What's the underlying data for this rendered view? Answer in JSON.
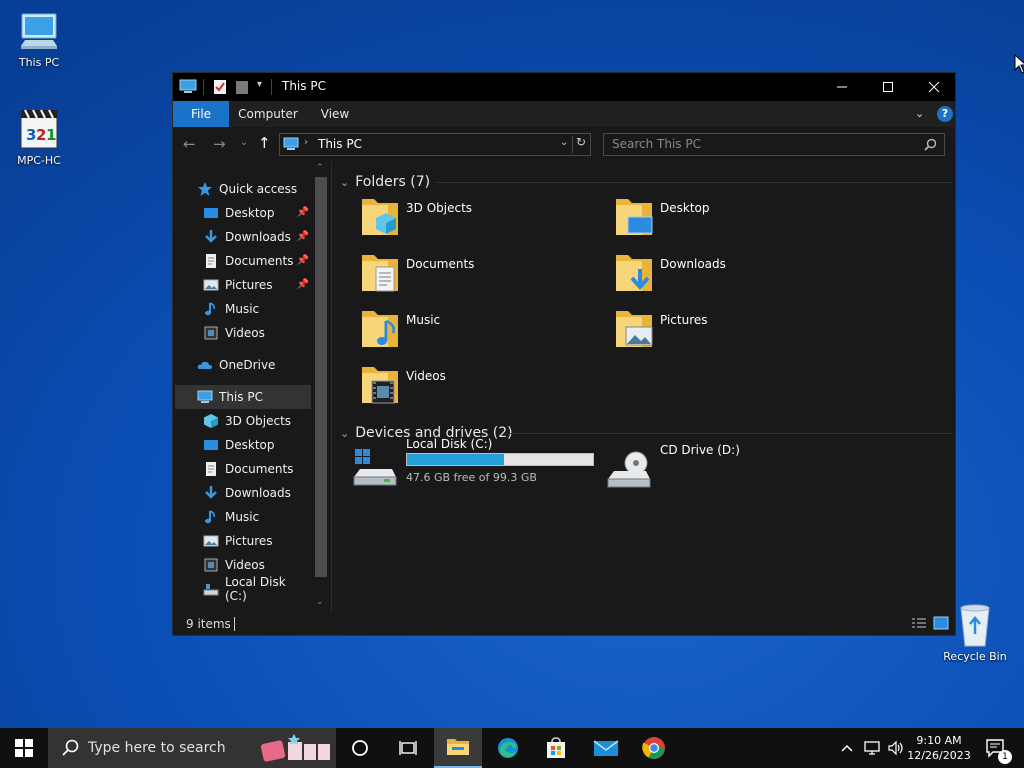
{
  "desktop": {
    "icons": [
      {
        "label": "This PC"
      },
      {
        "label": "MPC-HC"
      },
      {
        "label": "Recycle Bin"
      }
    ]
  },
  "window": {
    "title": "This PC",
    "ribbon_tabs": [
      "File",
      "Computer",
      "View"
    ],
    "address_path": "This PC",
    "search_placeholder": "Search This PC",
    "status_items": "9 items"
  },
  "nav": {
    "quick_access": "Quick access",
    "quick_items": [
      {
        "label": "Desktop",
        "pinned": true
      },
      {
        "label": "Downloads",
        "pinned": true
      },
      {
        "label": "Documents",
        "pinned": true
      },
      {
        "label": "Pictures",
        "pinned": true
      },
      {
        "label": "Music",
        "pinned": false
      },
      {
        "label": "Videos",
        "pinned": false
      }
    ],
    "onedrive": "OneDrive",
    "this_pc": "This PC",
    "pc_items": [
      "3D Objects",
      "Desktop",
      "Documents",
      "Downloads",
      "Music",
      "Pictures",
      "Videos",
      "Local Disk (C:)"
    ]
  },
  "content": {
    "folders_header": "Folders (7)",
    "folders": [
      "3D Objects",
      "Desktop",
      "Documents",
      "Downloads",
      "Music",
      "Pictures",
      "Videos"
    ],
    "devices_header": "Devices and drives (2)",
    "drives": [
      {
        "name": "Local Disk (C:)",
        "free_text": "47.6 GB free of 99.3 GB",
        "used_fraction": 0.52
      },
      {
        "name": "CD Drive (D:)"
      }
    ]
  },
  "taskbar": {
    "search_placeholder": "Type here to search",
    "time": "9:10 AM",
    "date": "12/26/2023",
    "notification_count": "1"
  },
  "colors": {
    "accent": "#0078d7",
    "folder": "#f0c84a",
    "drive_bar": "#26a0da"
  }
}
